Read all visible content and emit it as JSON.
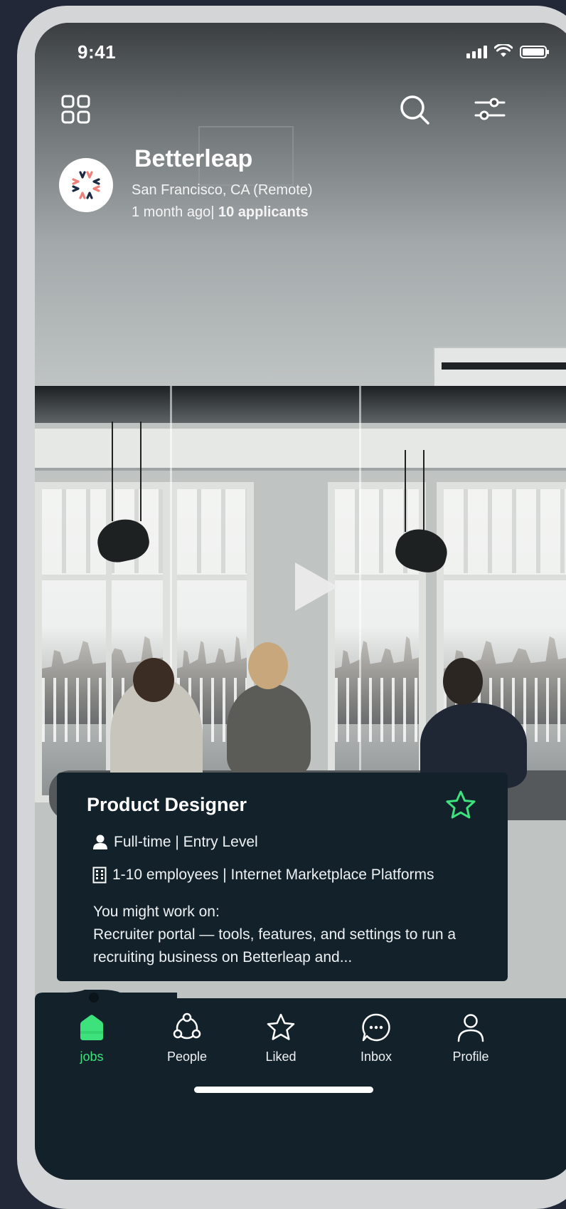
{
  "status_bar": {
    "time": "9:41"
  },
  "header": {
    "menu_icon": "grid-icon",
    "search_icon": "search-icon",
    "filter_icon": "sliders-icon"
  },
  "company": {
    "name": "Betterleap",
    "location": "San Francisco, CA (Remote)",
    "posted": "1 month ago|",
    "applicants": "10 applicants"
  },
  "job": {
    "title": "Product Designer",
    "type": "Full-time | Entry Level",
    "company_info": "1-10 employees | Internet Marketplace Platforms",
    "desc_intro": "You might work on:",
    "desc_body": "Recruiter portal — tools, features, and settings to run a recruiting business on Betterleap and..."
  },
  "tabs": [
    {
      "label": "jobs",
      "icon": "home-icon",
      "active": true
    },
    {
      "label": "People",
      "icon": "people-icon",
      "active": false
    },
    {
      "label": "Liked",
      "icon": "star-icon",
      "active": false
    },
    {
      "label": "Inbox",
      "icon": "chat-icon",
      "active": false
    },
    {
      "label": "Profile",
      "icon": "user-icon",
      "active": false
    }
  ],
  "colors": {
    "accent": "#3ee27d",
    "card": "#13212a",
    "frame": "#d4d5d7",
    "background": "#222838"
  }
}
